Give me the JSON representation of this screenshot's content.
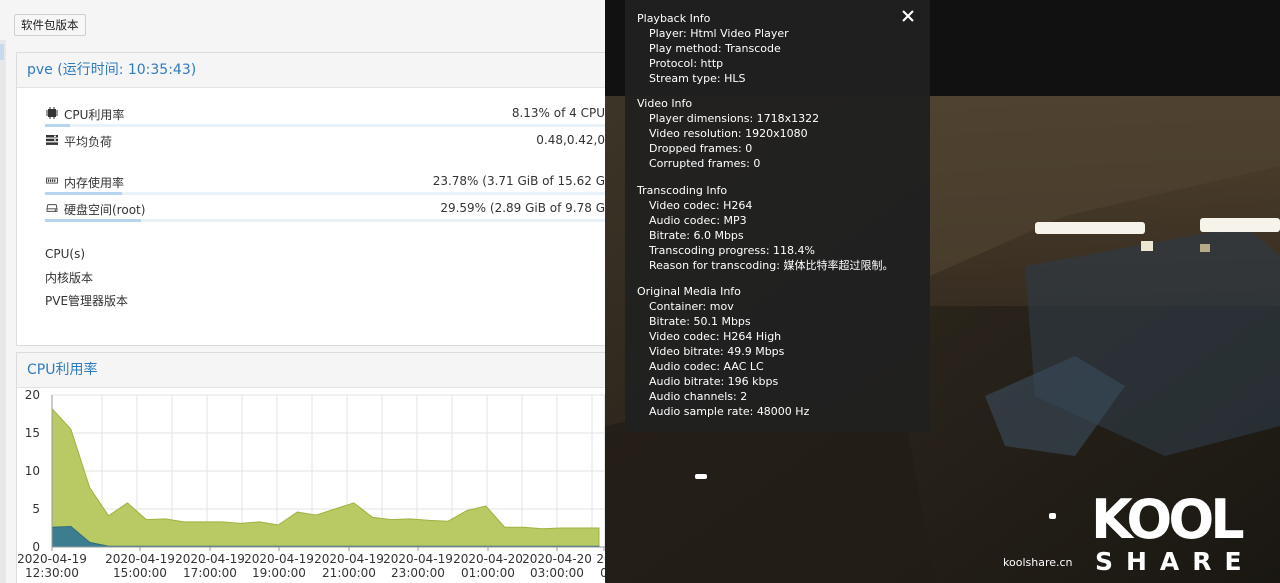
{
  "toolbar": {
    "package_versions_label": "软件包版本"
  },
  "status": {
    "title": "pve (运行时间: 10:35:43)",
    "cpu_usage": {
      "label": "CPU利用率",
      "value": "8.13% of 4 CPU",
      "fraction": 0.0813
    },
    "load_avg": {
      "label": "平均负荷",
      "value": "0.48,0.42,0"
    },
    "memory": {
      "label": "内存使用率",
      "value": "23.78% (3.71 GiB of 15.62 G",
      "fraction": 0.2378
    },
    "disk": {
      "label": "硬盘空间(root)",
      "value": "29.59% (2.89 GiB of 9.78 G",
      "fraction": 0.2959
    },
    "cpus_label": "CPU(s)",
    "kernel_label": "内核版本",
    "pve_manager_label": "PVE管理器版本"
  },
  "cpu_panel": {
    "title": "CPU利用率"
  },
  "chart_data": {
    "type": "area",
    "title": "CPU利用率",
    "ylim": [
      0,
      20
    ],
    "yticks": [
      "20",
      "15",
      "10",
      "5",
      "0"
    ],
    "x_tick_labels": [
      [
        "2020-04-19",
        "12:30:00"
      ],
      [
        "2020-04-19",
        "15:00:00"
      ],
      [
        "2020-04-19",
        "17:00:00"
      ],
      [
        "2020-04-19",
        "19:00:00"
      ],
      [
        "2020-04-19",
        "21:00:00"
      ],
      [
        "2020-04-19",
        "23:00:00"
      ],
      [
        "2020-04-20",
        "01:00:00"
      ],
      [
        "2020-04-20",
        "03:00:00"
      ],
      [
        "20",
        "0"
      ]
    ],
    "grid": true,
    "series": [
      {
        "color": "#b5c75c",
        "values": [
          18.2,
          15.5,
          7.8,
          4.1,
          5.8,
          3.6,
          3.7,
          3.3,
          3.3,
          3.3,
          3.1,
          3.3,
          2.9,
          4.6,
          4.2,
          5.0,
          5.8,
          3.9,
          3.6,
          3.7,
          3.5,
          3.4,
          4.8,
          5.4,
          2.6,
          2.6,
          2.4,
          2.5,
          2.5,
          2.5
        ]
      },
      {
        "color": "#3c7e8f",
        "values": [
          2.6,
          2.7,
          0.6,
          0.1,
          0.1,
          0.1,
          0.1,
          0.1,
          0.1,
          0.1,
          0.1,
          0.1,
          0.1,
          0.1,
          0.1,
          0.1,
          0.1,
          0.1,
          0.1,
          0.1,
          0.1,
          0.1,
          0.1,
          0.1,
          0.1,
          0.1,
          0.1,
          0.1,
          0.1,
          0.1
        ]
      }
    ]
  },
  "playback": {
    "close_icon": "close-icon",
    "sections": [
      {
        "title": "Playback Info",
        "items": [
          [
            "Player:",
            "Html Video Player"
          ],
          [
            "Play method:",
            "Transcode"
          ],
          [
            "Protocol:",
            "http"
          ],
          [
            "Stream type:",
            "HLS"
          ]
        ]
      },
      {
        "title": "Video Info",
        "items": [
          [
            "Player dimensions:",
            "1718x1322"
          ],
          [
            "Video resolution:",
            "1920x1080"
          ],
          [
            "Dropped frames:",
            "0"
          ],
          [
            "Corrupted frames:",
            "0"
          ]
        ]
      },
      {
        "title": "Transcoding Info",
        "items": [
          [
            "Video codec:",
            "H264"
          ],
          [
            "Audio codec:",
            "MP3"
          ],
          [
            "Bitrate:",
            "6.0 Mbps"
          ],
          [
            "Transcoding progress:",
            "118.4%"
          ],
          [
            "Reason for transcoding:",
            "媒体比特率超过限制。"
          ]
        ]
      },
      {
        "title": "Original Media Info",
        "items": [
          [
            "Container:",
            "mov"
          ],
          [
            "Bitrate:",
            "50.1 Mbps"
          ],
          [
            "Video codec:",
            "H264 High"
          ],
          [
            "Video bitrate:",
            "49.9 Mbps"
          ],
          [
            "Audio codec:",
            "AAC LC"
          ],
          [
            "Audio bitrate:",
            "196 kbps"
          ],
          [
            "Audio channels:",
            "2"
          ],
          [
            "Audio sample rate:",
            "48000 Hz"
          ]
        ]
      }
    ]
  },
  "watermark": {
    "site": "koolshare.cn",
    "logo_top": "KOOL",
    "logo_bottom": "SHARE"
  }
}
